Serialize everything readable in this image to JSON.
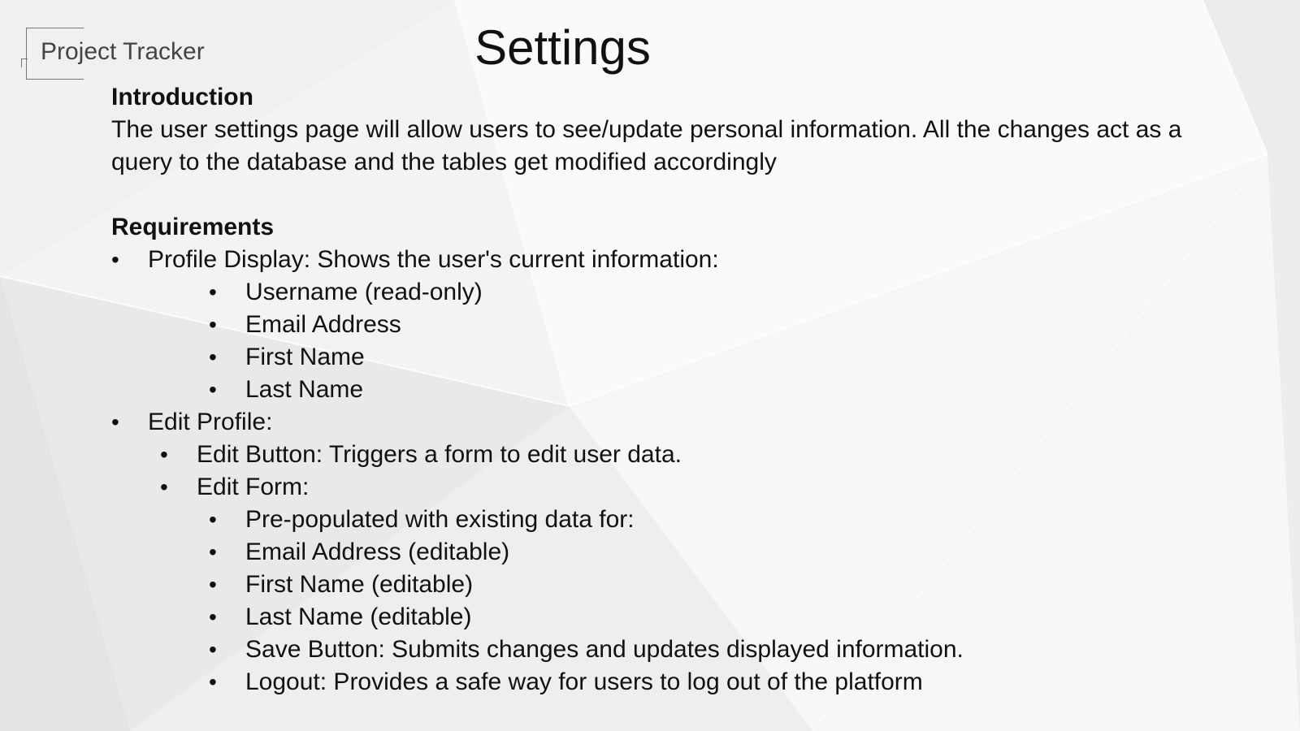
{
  "brand": {
    "name": "Project Tracker"
  },
  "page": {
    "title": "Settings"
  },
  "intro": {
    "heading": "Introduction",
    "body": "The user settings page will allow users to see/update personal information. All the changes act as a query to the database and the tables get modified accordingly"
  },
  "requirements": {
    "heading": "Requirements",
    "items": [
      {
        "level": 1,
        "text": "Profile Display: Shows the user's current information:"
      },
      {
        "level": 3,
        "text": "Username (read-only)"
      },
      {
        "level": 3,
        "text": "Email Address"
      },
      {
        "level": 3,
        "text": "First Name"
      },
      {
        "level": 3,
        "text": "Last Name"
      },
      {
        "level": 1,
        "text": "Edit Profile:"
      },
      {
        "level": 2,
        "text": "Edit Button: Triggers a form to edit user data."
      },
      {
        "level": 2,
        "text": "Edit Form:"
      },
      {
        "level": 3,
        "text": "Pre-populated with existing data for:"
      },
      {
        "level": 3,
        "text": "Email Address (editable)"
      },
      {
        "level": 3,
        "text": "First Name (editable)"
      },
      {
        "level": 3,
        "text": "Last Name (editable)"
      },
      {
        "level": 3,
        "text": "Save Button: Submits changes and updates displayed information."
      },
      {
        "level": 3,
        "text": "Logout: Provides a safe way for users to log out of the platform"
      }
    ]
  }
}
